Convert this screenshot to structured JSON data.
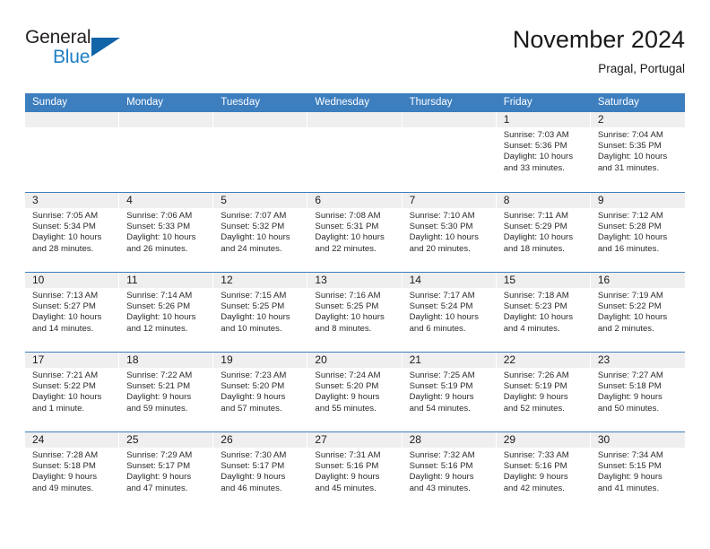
{
  "brand": {
    "name_top": "General",
    "name_bottom": "Blue",
    "accent_color": "#1264a8",
    "text_color": "#231f20"
  },
  "header": {
    "title": "November 2024",
    "location": "Pragal, Portugal"
  },
  "theme": {
    "header_blue": "#3d7ebf",
    "daynum_band": "#efefef",
    "cell_bg": "#ffffff"
  },
  "calendar": {
    "weekday_headers": [
      "Sunday",
      "Monday",
      "Tuesday",
      "Wednesday",
      "Thursday",
      "Friday",
      "Saturday"
    ],
    "weeks": [
      [
        {
          "day": "",
          "empty": true
        },
        {
          "day": "",
          "empty": true
        },
        {
          "day": "",
          "empty": true
        },
        {
          "day": "",
          "empty": true
        },
        {
          "day": "",
          "empty": true
        },
        {
          "day": "1",
          "sunrise": "Sunrise: 7:03 AM",
          "sunset": "Sunset: 5:36 PM",
          "daylight1": "Daylight: 10 hours",
          "daylight2": "and 33 minutes."
        },
        {
          "day": "2",
          "sunrise": "Sunrise: 7:04 AM",
          "sunset": "Sunset: 5:35 PM",
          "daylight1": "Daylight: 10 hours",
          "daylight2": "and 31 minutes."
        }
      ],
      [
        {
          "day": "3",
          "sunrise": "Sunrise: 7:05 AM",
          "sunset": "Sunset: 5:34 PM",
          "daylight1": "Daylight: 10 hours",
          "daylight2": "and 28 minutes."
        },
        {
          "day": "4",
          "sunrise": "Sunrise: 7:06 AM",
          "sunset": "Sunset: 5:33 PM",
          "daylight1": "Daylight: 10 hours",
          "daylight2": "and 26 minutes."
        },
        {
          "day": "5",
          "sunrise": "Sunrise: 7:07 AM",
          "sunset": "Sunset: 5:32 PM",
          "daylight1": "Daylight: 10 hours",
          "daylight2": "and 24 minutes."
        },
        {
          "day": "6",
          "sunrise": "Sunrise: 7:08 AM",
          "sunset": "Sunset: 5:31 PM",
          "daylight1": "Daylight: 10 hours",
          "daylight2": "and 22 minutes."
        },
        {
          "day": "7",
          "sunrise": "Sunrise: 7:10 AM",
          "sunset": "Sunset: 5:30 PM",
          "daylight1": "Daylight: 10 hours",
          "daylight2": "and 20 minutes."
        },
        {
          "day": "8",
          "sunrise": "Sunrise: 7:11 AM",
          "sunset": "Sunset: 5:29 PM",
          "daylight1": "Daylight: 10 hours",
          "daylight2": "and 18 minutes."
        },
        {
          "day": "9",
          "sunrise": "Sunrise: 7:12 AM",
          "sunset": "Sunset: 5:28 PM",
          "daylight1": "Daylight: 10 hours",
          "daylight2": "and 16 minutes."
        }
      ],
      [
        {
          "day": "10",
          "sunrise": "Sunrise: 7:13 AM",
          "sunset": "Sunset: 5:27 PM",
          "daylight1": "Daylight: 10 hours",
          "daylight2": "and 14 minutes."
        },
        {
          "day": "11",
          "sunrise": "Sunrise: 7:14 AM",
          "sunset": "Sunset: 5:26 PM",
          "daylight1": "Daylight: 10 hours",
          "daylight2": "and 12 minutes."
        },
        {
          "day": "12",
          "sunrise": "Sunrise: 7:15 AM",
          "sunset": "Sunset: 5:25 PM",
          "daylight1": "Daylight: 10 hours",
          "daylight2": "and 10 minutes."
        },
        {
          "day": "13",
          "sunrise": "Sunrise: 7:16 AM",
          "sunset": "Sunset: 5:25 PM",
          "daylight1": "Daylight: 10 hours",
          "daylight2": "and 8 minutes."
        },
        {
          "day": "14",
          "sunrise": "Sunrise: 7:17 AM",
          "sunset": "Sunset: 5:24 PM",
          "daylight1": "Daylight: 10 hours",
          "daylight2": "and 6 minutes."
        },
        {
          "day": "15",
          "sunrise": "Sunrise: 7:18 AM",
          "sunset": "Sunset: 5:23 PM",
          "daylight1": "Daylight: 10 hours",
          "daylight2": "and 4 minutes."
        },
        {
          "day": "16",
          "sunrise": "Sunrise: 7:19 AM",
          "sunset": "Sunset: 5:22 PM",
          "daylight1": "Daylight: 10 hours",
          "daylight2": "and 2 minutes."
        }
      ],
      [
        {
          "day": "17",
          "sunrise": "Sunrise: 7:21 AM",
          "sunset": "Sunset: 5:22 PM",
          "daylight1": "Daylight: 10 hours",
          "daylight2": "and 1 minute."
        },
        {
          "day": "18",
          "sunrise": "Sunrise: 7:22 AM",
          "sunset": "Sunset: 5:21 PM",
          "daylight1": "Daylight: 9 hours",
          "daylight2": "and 59 minutes."
        },
        {
          "day": "19",
          "sunrise": "Sunrise: 7:23 AM",
          "sunset": "Sunset: 5:20 PM",
          "daylight1": "Daylight: 9 hours",
          "daylight2": "and 57 minutes."
        },
        {
          "day": "20",
          "sunrise": "Sunrise: 7:24 AM",
          "sunset": "Sunset: 5:20 PM",
          "daylight1": "Daylight: 9 hours",
          "daylight2": "and 55 minutes."
        },
        {
          "day": "21",
          "sunrise": "Sunrise: 7:25 AM",
          "sunset": "Sunset: 5:19 PM",
          "daylight1": "Daylight: 9 hours",
          "daylight2": "and 54 minutes."
        },
        {
          "day": "22",
          "sunrise": "Sunrise: 7:26 AM",
          "sunset": "Sunset: 5:19 PM",
          "daylight1": "Daylight: 9 hours",
          "daylight2": "and 52 minutes."
        },
        {
          "day": "23",
          "sunrise": "Sunrise: 7:27 AM",
          "sunset": "Sunset: 5:18 PM",
          "daylight1": "Daylight: 9 hours",
          "daylight2": "and 50 minutes."
        }
      ],
      [
        {
          "day": "24",
          "sunrise": "Sunrise: 7:28 AM",
          "sunset": "Sunset: 5:18 PM",
          "daylight1": "Daylight: 9 hours",
          "daylight2": "and 49 minutes."
        },
        {
          "day": "25",
          "sunrise": "Sunrise: 7:29 AM",
          "sunset": "Sunset: 5:17 PM",
          "daylight1": "Daylight: 9 hours",
          "daylight2": "and 47 minutes."
        },
        {
          "day": "26",
          "sunrise": "Sunrise: 7:30 AM",
          "sunset": "Sunset: 5:17 PM",
          "daylight1": "Daylight: 9 hours",
          "daylight2": "and 46 minutes."
        },
        {
          "day": "27",
          "sunrise": "Sunrise: 7:31 AM",
          "sunset": "Sunset: 5:16 PM",
          "daylight1": "Daylight: 9 hours",
          "daylight2": "and 45 minutes."
        },
        {
          "day": "28",
          "sunrise": "Sunrise: 7:32 AM",
          "sunset": "Sunset: 5:16 PM",
          "daylight1": "Daylight: 9 hours",
          "daylight2": "and 43 minutes."
        },
        {
          "day": "29",
          "sunrise": "Sunrise: 7:33 AM",
          "sunset": "Sunset: 5:16 PM",
          "daylight1": "Daylight: 9 hours",
          "daylight2": "and 42 minutes."
        },
        {
          "day": "30",
          "sunrise": "Sunrise: 7:34 AM",
          "sunset": "Sunset: 5:15 PM",
          "daylight1": "Daylight: 9 hours",
          "daylight2": "and 41 minutes."
        }
      ]
    ]
  }
}
